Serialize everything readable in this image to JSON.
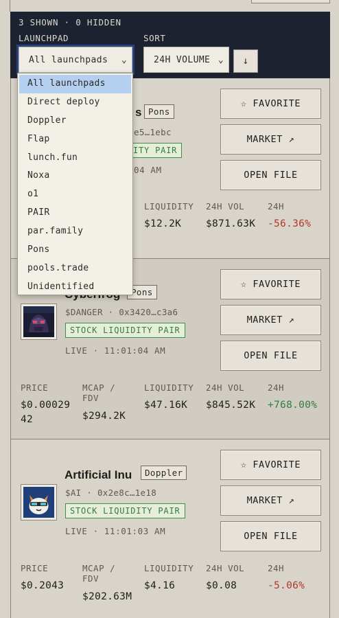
{
  "header": {
    "counts": "3 SHOWN · 0 HIDDEN",
    "launchpad_label": "LAUNCHPAD",
    "launchpad_value": "All launchpads",
    "sort_label": "SORT",
    "sort_value": "24H VOLUME",
    "sort_direction_icon": "↓"
  },
  "dropdown": {
    "options": [
      "All launchpads",
      "Direct deploy",
      "Doppler",
      "Flap",
      "lunch.fun",
      "Noxa",
      "o1",
      "PAIR",
      "par.family",
      "Pons",
      "pools.trade",
      "Unidentified"
    ],
    "selected_index": 0,
    "highlight_color": "#b5cff0"
  },
  "buttons": {
    "favorite": "☆ FAVORITE",
    "market": "MARKET ↗",
    "open_file": "OPEN FILE"
  },
  "metric_labels": {
    "price": "PRICE",
    "mcap": "MCAP / FDV",
    "liquidity": "LIQUIDITY",
    "vol": "24H VOL",
    "change": "24H"
  },
  "cards": [
    {
      "name": "s",
      "launchpad": "Pons",
      "symbol_line": "e5…1ebc",
      "pair": "ITY PAIR",
      "live": "04 AM",
      "price": "",
      "mcap": "",
      "liquidity": "$12.2K",
      "vol": "$871.63K",
      "change": "-56.36%",
      "change_dir": "neg"
    },
    {
      "name": "Cyberfrog",
      "launchpad": "Pons",
      "symbol_line": "$DANGER · 0x3420…c3a6",
      "pair": "STOCK LIQUIDITY PAIR",
      "live": "LIVE · 11:01:04 AM",
      "price": "$0.00029\n42",
      "mcap": "$294.2K",
      "liquidity": "$47.16K",
      "vol": "$845.52K",
      "change": "+768.00%",
      "change_dir": "pos"
    },
    {
      "name": "Artificial Inu",
      "launchpad": "Doppler",
      "symbol_line": "$AI · 0x2e8c…1e18",
      "pair": "STOCK LIQUIDITY PAIR",
      "live": "LIVE · 11:01:03 AM",
      "price": "$0.2043",
      "mcap": "$202.63M",
      "liquidity": "$4.16",
      "vol": "$0.08",
      "change": "-5.06%",
      "change_dir": "neg"
    }
  ],
  "colors": {
    "header_bg": "#1d2230",
    "page_bg": "#d8d4ca",
    "negative": "#b3372b",
    "positive": "#2f7d3d"
  }
}
